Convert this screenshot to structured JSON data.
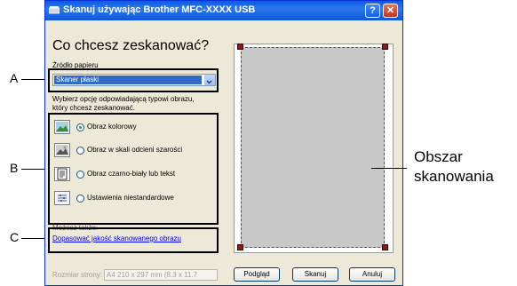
{
  "window": {
    "title": "Skanuj używając Brother MFC-XXXX USB",
    "help_label": "?",
    "close_label": "✕"
  },
  "dialog": {
    "heading": "Co chcesz zeskanować?",
    "source_label": "Źródło papieru",
    "source_value": "Skaner płaski",
    "instruction_line1": "Wybierz opcję odpowiadającą typowi obrazu,",
    "instruction_line2": "który chcesz zeskanować.",
    "options": [
      {
        "label": "Obraz kolorowy",
        "checked": true,
        "icon": "color-photo-icon"
      },
      {
        "label": "Obraz w skali odcieni szarości",
        "checked": false,
        "icon": "grayscale-photo-icon"
      },
      {
        "label": "Obraz czarno-biały lub tekst",
        "checked": false,
        "icon": "bw-text-icon"
      },
      {
        "label": "Ustawienia niestandardowe",
        "checked": false,
        "icon": "custom-settings-icon"
      }
    ],
    "also_label": "Możesz także:",
    "adjust_link": "Dopasować jakość skanowanego obrazu",
    "page_size_label": "Rozmiar strony:",
    "page_size_value": "A4 210 x 297 mm (8.3 x 11.7",
    "buttons": {
      "preview": "Podgląd",
      "scan": "Skanuj",
      "cancel": "Anuluj"
    }
  },
  "callouts": {
    "a": "A",
    "b": "B",
    "c": "C"
  },
  "annotation": {
    "line1": "Obszar",
    "line2": "skanowania"
  }
}
